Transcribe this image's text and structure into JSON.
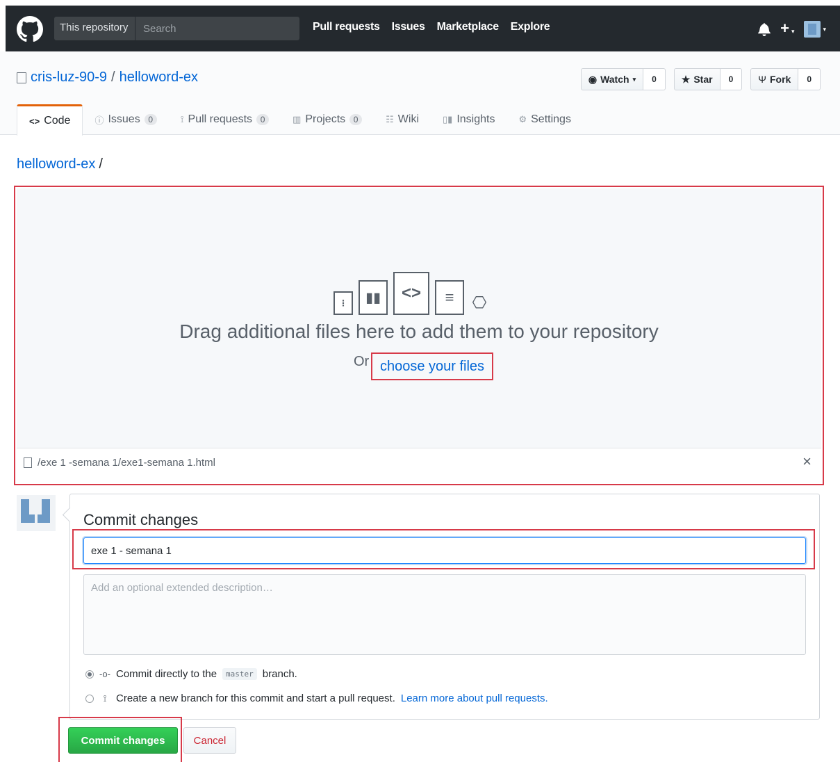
{
  "header": {
    "scope": "This repository",
    "search_placeholder": "Search",
    "nav": [
      "Pull requests",
      "Issues",
      "Marketplace",
      "Explore"
    ]
  },
  "repo": {
    "owner": "cris-luz-90-9",
    "separator": "/",
    "name": "helloword-ex",
    "watch_label": "Watch",
    "watch_count": "0",
    "star_label": "Star",
    "star_count": "0",
    "fork_label": "Fork",
    "fork_count": "0"
  },
  "tabs": [
    {
      "label": "Code",
      "icon": "code-icon"
    },
    {
      "label": "Issues",
      "count": "0",
      "icon": "issue-icon"
    },
    {
      "label": "Pull requests",
      "count": "0",
      "icon": "pr-icon"
    },
    {
      "label": "Projects",
      "count": "0",
      "icon": "project-icon"
    },
    {
      "label": "Wiki",
      "icon": "wiki-icon"
    },
    {
      "label": "Insights",
      "icon": "graph-icon"
    },
    {
      "label": "Settings",
      "icon": "gear-icon"
    }
  ],
  "breadcrumb": {
    "repo": "helloword-ex",
    "slash": "/"
  },
  "upload": {
    "title": "Drag additional files here to add them to your repository",
    "or": "Or",
    "choose": "choose your files",
    "file_path": "/exe 1 -semana 1/exe1-semana 1.html"
  },
  "commit": {
    "heading": "Commit changes",
    "summary_value": "exe 1 - semana 1",
    "description_placeholder": "Add an optional extended description…",
    "option_direct_pre": "Commit directly to the",
    "branch": "master",
    "option_direct_post": "branch.",
    "option_new": "Create a new branch for this commit and start a pull request.",
    "learn_more": "Learn more about pull requests.",
    "submit": "Commit changes",
    "cancel": "Cancel"
  },
  "colors": {
    "header_bg": "#24292e",
    "link": "#0366d6",
    "primary_button": "#28a745",
    "highlight": "#d73a49",
    "tab_accent": "#e36209"
  }
}
